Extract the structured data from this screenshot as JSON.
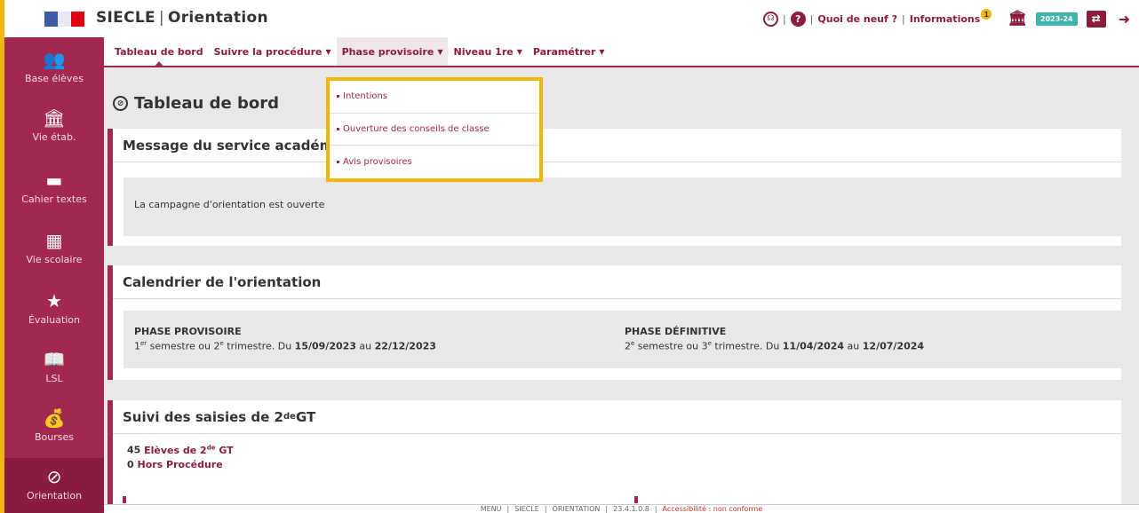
{
  "header": {
    "title": "SIECLE",
    "module": "Orientation",
    "quoi_de_neuf": "Quoi de neuf ?",
    "informations": "Informations",
    "notif_count": "1",
    "year": "2023-24"
  },
  "sidebar": {
    "items": [
      {
        "label": "Base élèves",
        "icon": "students-icon"
      },
      {
        "label": "Vie étab.",
        "icon": "institution-icon"
      },
      {
        "label": "Cahier textes",
        "icon": "notebook-icon"
      },
      {
        "label": "Vie scolaire",
        "icon": "calendar-icon"
      },
      {
        "label": "Évaluation",
        "icon": "star-icon"
      },
      {
        "label": "LSL",
        "icon": "book-icon"
      },
      {
        "label": "Bourses",
        "icon": "money-bag-icon"
      },
      {
        "label": "Orientation",
        "icon": "compass-icon"
      }
    ]
  },
  "menu": {
    "items": [
      {
        "label": "Tableau de bord"
      },
      {
        "label": "Suivre la procédure"
      },
      {
        "label": "Phase provisoire"
      },
      {
        "label": "Niveau 1re"
      },
      {
        "label": "Paramétrer"
      }
    ],
    "dropdown": [
      "Intentions",
      "Ouverture des conseils de classe",
      "Avis provisoires"
    ]
  },
  "page": {
    "title": "Tableau de bord",
    "message_panel": {
      "title": "Message du service académ",
      "text": "La campagne d'orientation est ouverte"
    },
    "calendar_panel": {
      "title": "Calendrier de l'orientation",
      "phase1": {
        "title": "PHASE PROVISOIRE",
        "n1": "1",
        "s1": "er",
        "t1": " semestre ou 2",
        "s2": "e",
        "t2": " trimestre. Du ",
        "from": "15/09/2023",
        "au": " au ",
        "to": "22/12/2023"
      },
      "phase2": {
        "title": "PHASE DÉFINITIVE",
        "n1": "2",
        "s1": "e",
        "t1": " semestre ou 3",
        "s2": "e",
        "t2": " trimestre. Du ",
        "from": "11/04/2024",
        "au": " au ",
        "to": "12/07/2024"
      }
    },
    "suivi_panel": {
      "title_a": "Suivi des saisies de 2",
      "title_sup": "de",
      "title_b": " GT",
      "line1_count": "45",
      "line1_a": " Elèves de 2",
      "line1_sup": "de",
      "line1_b": " GT",
      "line2_count": "0",
      "line2_text": " Hors Procédure"
    }
  },
  "footer": {
    "items": [
      "MENU",
      "SIECLE",
      "ORIENTATION",
      "23.4.1.0.8"
    ],
    "accessibility": "Accessibilité : non conforme"
  },
  "colors": {
    "brand": "#a3284f",
    "accent": "#f2b705",
    "teal": "#3fb5a9"
  }
}
